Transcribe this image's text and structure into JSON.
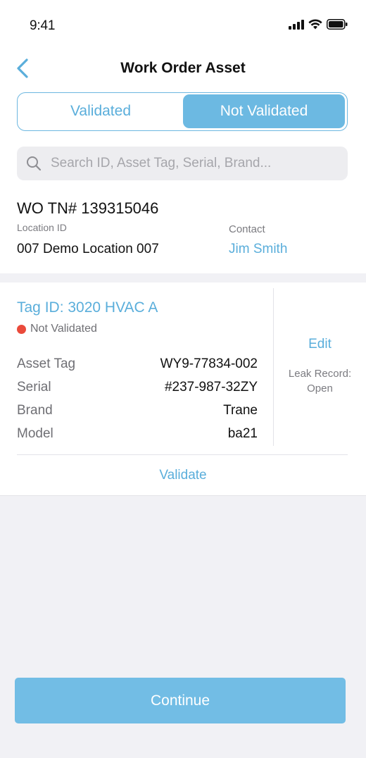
{
  "status_bar": {
    "time": "9:41"
  },
  "nav": {
    "title": "Work Order Asset",
    "back_icon": "chevron-left-icon"
  },
  "segmented": {
    "options": [
      "Validated",
      "Not Validated"
    ],
    "selected": "Not Validated"
  },
  "search": {
    "placeholder": "Search ID, Asset Tag, Serial, Brand...",
    "value": ""
  },
  "work_order": {
    "number": "WO TN# 139315046",
    "location_label": "Location ID",
    "location_value": "007 Demo Location 007",
    "contact_label": "Contact",
    "contact_value": "Jim Smith"
  },
  "asset": {
    "tag_id": "Tag ID: 3020 HVAC A",
    "status": "Not Validated",
    "status_color": "#ea4a3b",
    "details": [
      {
        "label": "Asset Tag",
        "value": "WY9-77834-002"
      },
      {
        "label": "Serial",
        "value": "#237-987-32ZY"
      },
      {
        "label": "Brand",
        "value": "Trane"
      },
      {
        "label": "Model",
        "value": "ba21"
      }
    ],
    "edit_label": "Edit",
    "leak_record_label": "Leak Record:",
    "leak_record_value": "Open",
    "validate_label": "Validate"
  },
  "footer": {
    "continue_label": "Continue"
  },
  "colors": {
    "accent": "#5aaedb",
    "button": "#72bde5",
    "background": "#f1f1f5"
  }
}
